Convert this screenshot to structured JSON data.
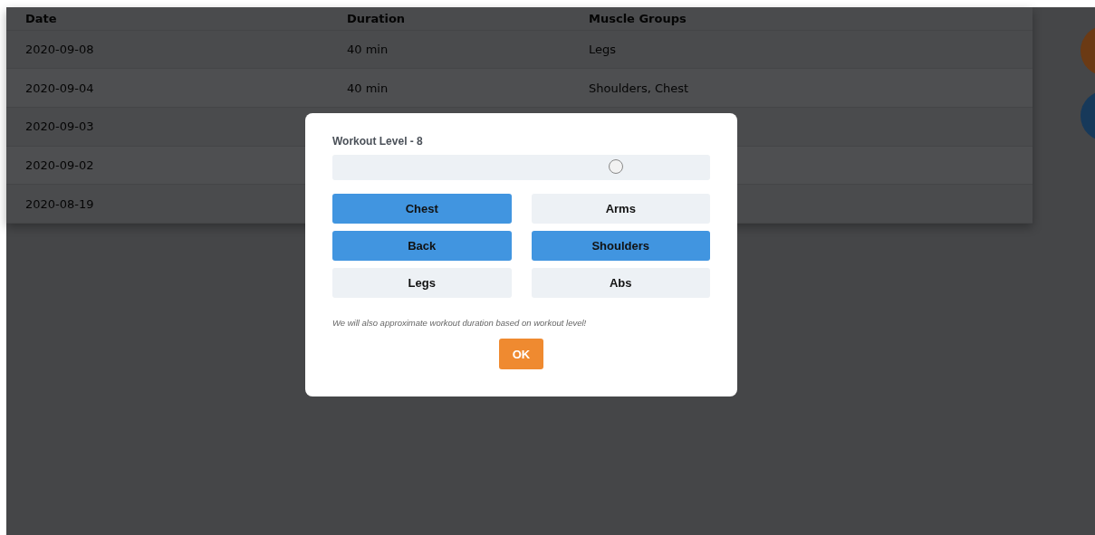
{
  "table": {
    "columns": [
      "Date",
      "Duration",
      "Muscle Groups"
    ],
    "rows": [
      [
        "2020-09-08",
        "40 min",
        "Legs"
      ],
      [
        "2020-09-04",
        "40 min",
        "Shoulders, Chest"
      ],
      [
        "2020-09-03"
      ],
      [
        "2020-09-02"
      ],
      [
        "2020-08-19"
      ]
    ]
  },
  "side_buttons": [
    {
      "color": "#6b3a14"
    },
    {
      "color": "#17395a"
    }
  ],
  "dialog": {
    "title": "Workout Level - 8",
    "slider": {
      "level": 0.75
    },
    "muscle_groups": [
      {
        "label": "Chest",
        "selected": true
      },
      {
        "label": "Arms",
        "selected": false
      },
      {
        "label": "Back",
        "selected": true
      },
      {
        "label": "Shoulders",
        "selected": true
      },
      {
        "label": "Legs",
        "selected": false
      },
      {
        "label": "Abs",
        "selected": false
      }
    ],
    "note": "We will also approximate workout duration based on workout level!",
    "ok_button": "OK"
  }
}
